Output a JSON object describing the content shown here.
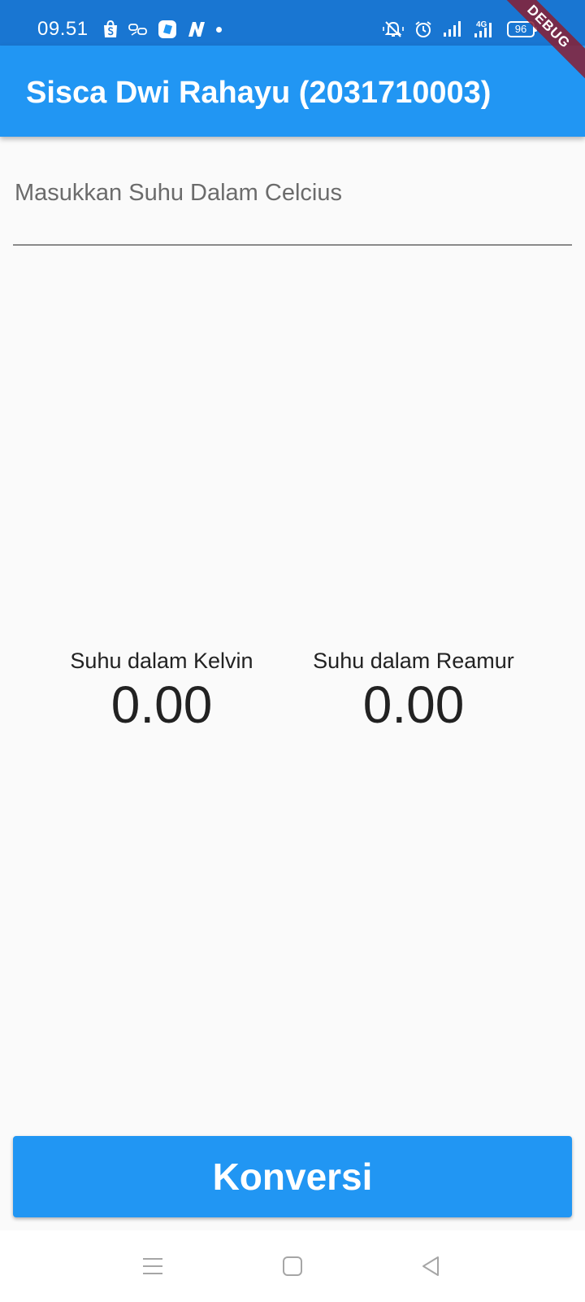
{
  "status_bar": {
    "time": "09.51",
    "battery_level": "96",
    "network": "4G",
    "left_icons": [
      "shopee-icon",
      "link-icon",
      "app-icon",
      "n-app-icon",
      "notification-dot-icon"
    ],
    "right_icons": [
      "mute-icon",
      "alarm-icon",
      "signal-icon",
      "signal-4g-icon",
      "battery-icon"
    ],
    "background_color": "#1976d2"
  },
  "debug_banner": {
    "label": "DEBUG"
  },
  "app_bar": {
    "title": "Sisca Dwi Rahayu (2031710003)",
    "background_color": "#2196f3"
  },
  "input": {
    "placeholder": "Masukkan Suhu Dalam Celcius",
    "value": ""
  },
  "results": {
    "kelvin": {
      "label": "Suhu dalam Kelvin",
      "value": "0.00"
    },
    "reamur": {
      "label": "Suhu dalam Reamur",
      "value": "0.00"
    }
  },
  "convert_button": {
    "label": "Konversi",
    "color": "#2196f3"
  },
  "nav_bar": {
    "icons": [
      "menu-icon",
      "home-icon",
      "back-icon"
    ]
  }
}
